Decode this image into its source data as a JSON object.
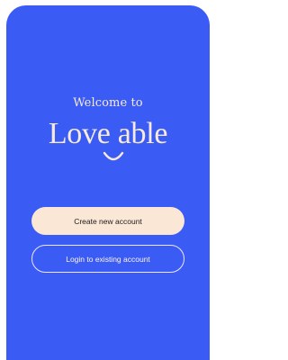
{
  "welcome_text": "Welcome to",
  "logo_text": "Love able",
  "buttons": {
    "create_account": "Create new account",
    "login_existing": "Login to existing account"
  },
  "colors": {
    "background": "#3b5bf5",
    "cream": "#f7ead9",
    "primary_button_bg": "#fbe7d6"
  }
}
